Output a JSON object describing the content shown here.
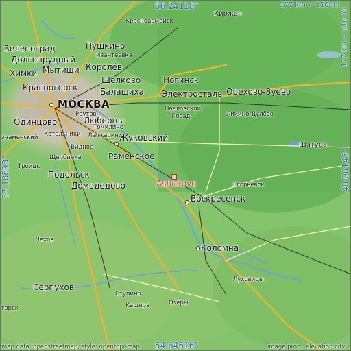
{
  "map": {
    "highlight_place": "Ashitkovo",
    "highlight_color": "#e23a3a",
    "coords": {
      "top": "56.24118°",
      "bottom": "54.64616°",
      "left": "37.18893°",
      "right": "40.00143°"
    },
    "scale": {
      "horizontal": "177 km = 110 mi",
      "vertical": "177 km = 110 mi"
    },
    "credits": {
      "left": "map data: openstreetmap, style: opentopomap",
      "right": "image proc.: elevation.city"
    },
    "places": [
      {
        "id": "moskva",
        "name": "МОСКВА",
        "size": "big"
      },
      {
        "id": "kirzhach",
        "name": "Киржач",
        "size": "town"
      },
      {
        "id": "krasnoarmeysk",
        "name": "Красноармейск",
        "size": "town"
      },
      {
        "id": "pushkino",
        "name": "Пушкино",
        "size": "city"
      },
      {
        "id": "ivanteevka",
        "name": "Ивантеевка",
        "size": "town"
      },
      {
        "id": "zelenograd",
        "name": "Зеленоград",
        "size": "city"
      },
      {
        "id": "dolgoprudny",
        "name": "Долгопрудный",
        "size": "city"
      },
      {
        "id": "mytishchi",
        "name": "Мытищи",
        "size": "city"
      },
      {
        "id": "khimki",
        "name": "Химки",
        "size": "city"
      },
      {
        "id": "korolev",
        "name": "Королёв",
        "size": "city"
      },
      {
        "id": "shchelkovo",
        "name": "Щёлково",
        "size": "city"
      },
      {
        "id": "noginsk",
        "name": "Ногинск",
        "size": "city"
      },
      {
        "id": "krasnogorsk",
        "name": "Красногорск",
        "size": "city"
      },
      {
        "id": "balashikha",
        "name": "Балашиха",
        "size": "city"
      },
      {
        "id": "elektrostal",
        "name": "Электросталь",
        "size": "city"
      },
      {
        "id": "orekhovo",
        "name": "Орехово-Зуево",
        "size": "city"
      },
      {
        "id": "pavlovsky",
        "name": "Павловский",
        "size": "town"
      },
      {
        "id": "posad",
        "name": "Посад",
        "size": "town"
      },
      {
        "id": "likino",
        "name": "Ликино-Дулёво",
        "size": "town"
      },
      {
        "id": "odintsovo",
        "name": "Одинцово",
        "size": "city"
      },
      {
        "id": "reutov",
        "name": "Реутов",
        "size": "small"
      },
      {
        "id": "lyubertsy",
        "name": "Люберцы",
        "size": "city"
      },
      {
        "id": "tomilino",
        "name": "Томилино",
        "size": "small"
      },
      {
        "id": "kotelniki",
        "name": "Котельники",
        "size": "small"
      },
      {
        "id": "lytkarino",
        "name": "Лыткарино",
        "size": "small"
      },
      {
        "id": "znamensky",
        "name": "знаменский",
        "size": "small"
      },
      {
        "id": "vidnoe",
        "name": "Видное",
        "size": "small"
      },
      {
        "id": "zhukovsky",
        "name": "Жуковский",
        "size": "city"
      },
      {
        "id": "ramenskoe",
        "name": "Раменское",
        "size": "city"
      },
      {
        "id": "shcherbinka",
        "name": "Щербинка",
        "size": "small"
      },
      {
        "id": "troitsk",
        "name": "Троицк",
        "size": "small"
      },
      {
        "id": "podolsk",
        "name": "Подольск",
        "size": "city"
      },
      {
        "id": "domodedovo",
        "name": "Домодедово",
        "size": "city"
      },
      {
        "id": "ashitkovo",
        "name": "Ashitkovo",
        "size": "city"
      },
      {
        "id": "shatura",
        "name": "Шатура",
        "size": "town"
      },
      {
        "id": "egorevsk",
        "name": "Егорьевск",
        "size": "town"
      },
      {
        "id": "voskresensk",
        "name": "Воскресенск",
        "size": "city"
      },
      {
        "id": "kolomna",
        "name": "Коломна",
        "size": "city"
      },
      {
        "id": "chekhov",
        "name": "Чехов",
        "size": "small"
      },
      {
        "id": "lukhovitsy",
        "name": "Луховицы",
        "size": "town"
      },
      {
        "id": "serpukhov",
        "name": "Серпухов",
        "size": "city"
      },
      {
        "id": "stupino",
        "name": "Ступино",
        "size": "small"
      },
      {
        "id": "kashira",
        "name": "Кашира",
        "size": "small"
      },
      {
        "id": "ozery",
        "name": "Озёры",
        "size": "small"
      },
      {
        "id": "gorsk",
        "name": "горск",
        "size": "small"
      }
    ]
  }
}
